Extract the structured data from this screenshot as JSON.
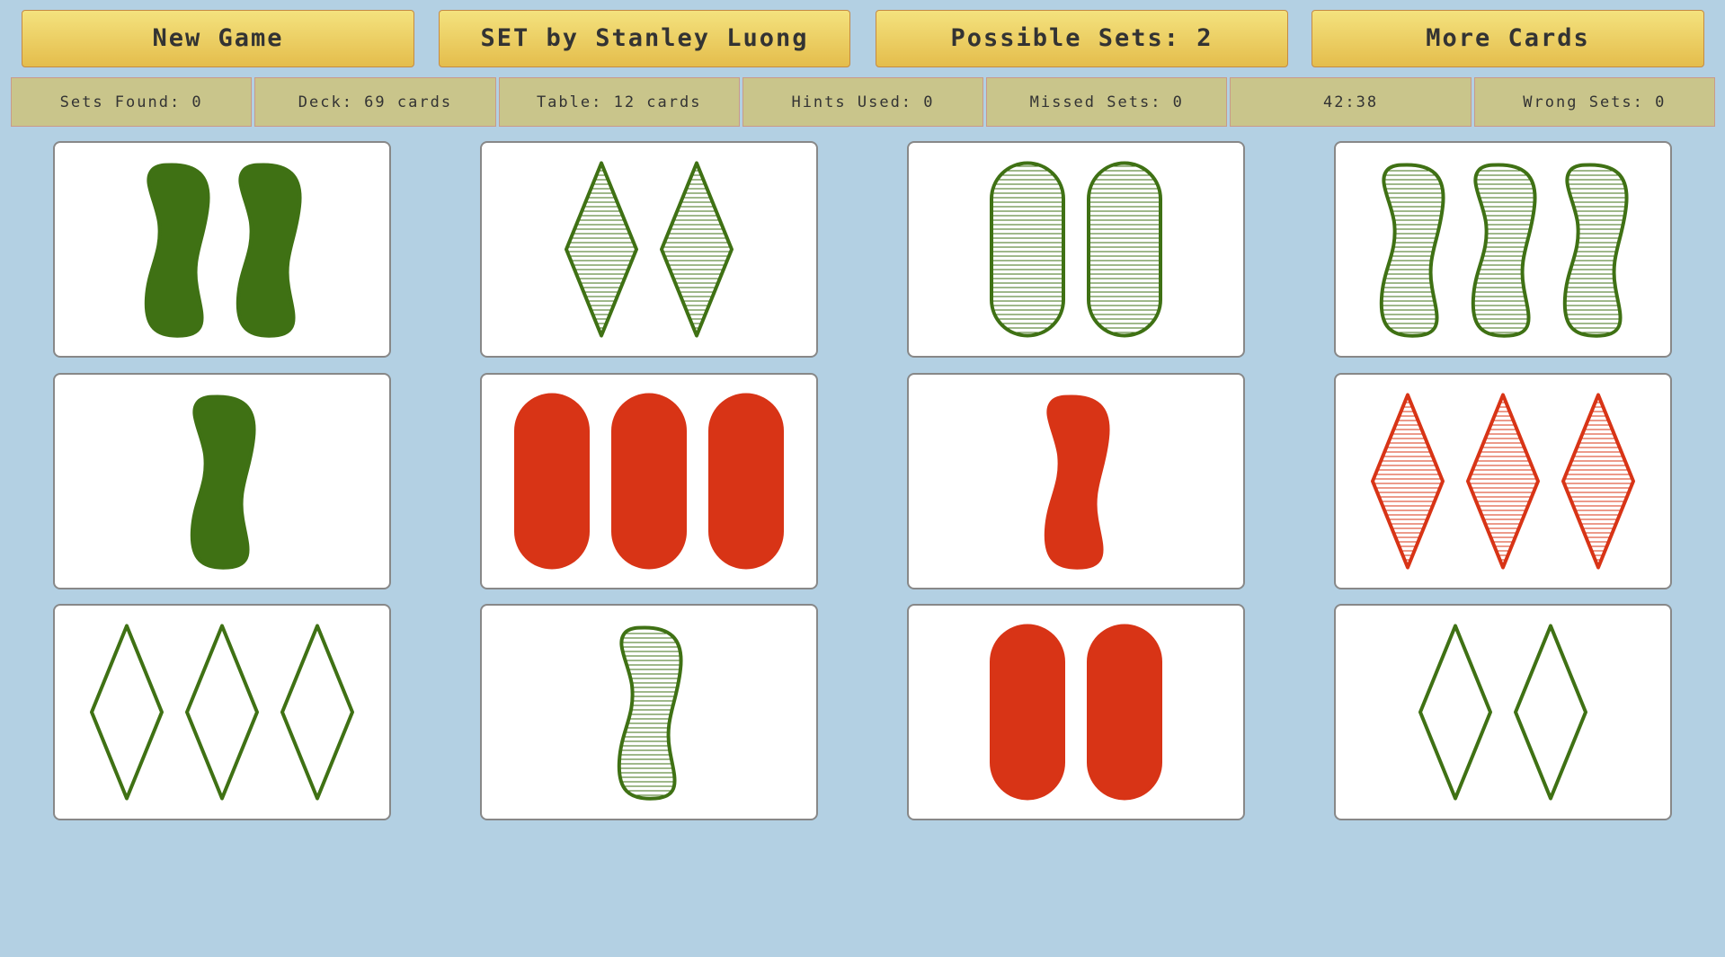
{
  "header": {
    "new_game_label": "New Game",
    "title_label": "SET by Stanley Luong",
    "possible_sets_label": "Possible Sets: 2",
    "more_cards_label": "More Cards"
  },
  "stats": {
    "sets_found": "Sets Found: 0",
    "deck": "Deck: 69 cards",
    "table": "Table: 12 cards",
    "hints_used": "Hints Used: 0",
    "missed_sets": "Missed Sets: 0",
    "timer": "42:38",
    "wrong_sets": "Wrong Sets: 0"
  },
  "colors": {
    "green": "#3f7114",
    "red": "#d83416"
  },
  "cards": [
    {
      "count": 2,
      "shape": "squiggle",
      "color": "green",
      "fill": "solid"
    },
    {
      "count": 2,
      "shape": "diamond",
      "color": "green",
      "fill": "striped"
    },
    {
      "count": 2,
      "shape": "oval",
      "color": "green",
      "fill": "striped"
    },
    {
      "count": 3,
      "shape": "squiggle",
      "color": "green",
      "fill": "striped"
    },
    {
      "count": 1,
      "shape": "squiggle",
      "color": "green",
      "fill": "solid"
    },
    {
      "count": 3,
      "shape": "oval",
      "color": "red",
      "fill": "solid"
    },
    {
      "count": 1,
      "shape": "squiggle",
      "color": "red",
      "fill": "solid"
    },
    {
      "count": 3,
      "shape": "diamond",
      "color": "red",
      "fill": "striped"
    },
    {
      "count": 3,
      "shape": "diamond",
      "color": "green",
      "fill": "empty"
    },
    {
      "count": 1,
      "shape": "squiggle",
      "color": "green",
      "fill": "striped"
    },
    {
      "count": 2,
      "shape": "oval",
      "color": "red",
      "fill": "solid"
    },
    {
      "count": 2,
      "shape": "diamond",
      "color": "green",
      "fill": "empty"
    }
  ]
}
